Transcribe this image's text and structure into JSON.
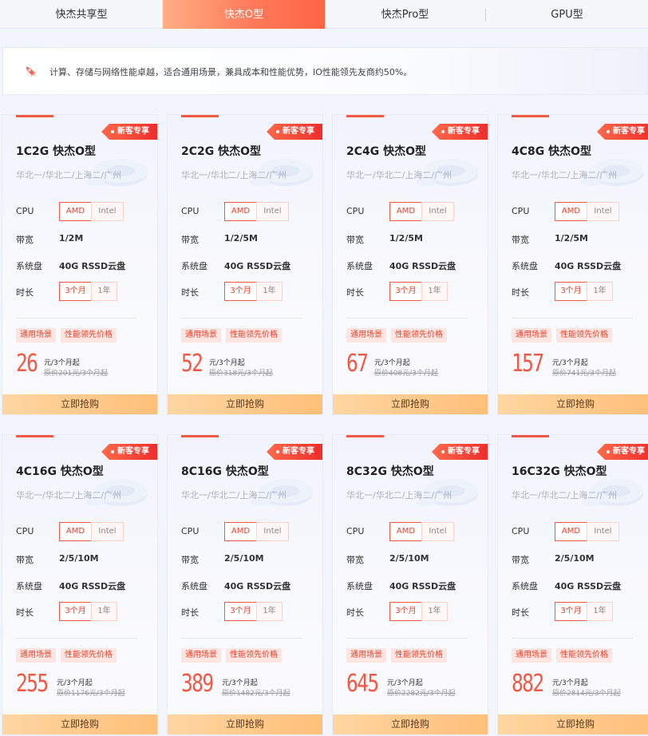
{
  "tabs": [
    {
      "label": "快杰共享型",
      "active": false
    },
    {
      "label": "快杰O型",
      "active": true
    },
    {
      "label": "快杰Pro型",
      "active": false
    },
    {
      "label": "GPU型",
      "active": false
    }
  ],
  "banner": {
    "icon": "rocket-icon",
    "text": "计算、存储与网络性能卓越，适合通用场景，兼具成本和性能优势，IO性能领先友商约50%。"
  },
  "labels": {
    "badge": "新客专享",
    "cpu": "CPU",
    "bandwidth": "带宽",
    "disk": "系统盘",
    "duration": "时长",
    "amd": "AMD",
    "intel": "Intel",
    "months3": "3个月",
    "year1": "1年",
    "tag1": "通用场景",
    "tag2": "性能领先价格",
    "price_unit": "元/3个月起",
    "buy": "立即抢购"
  },
  "colors": {
    "accent": "#f05a45",
    "buy_button": "#ffbf79",
    "tab_active": "#ff7a5a"
  },
  "cards": [
    {
      "title": "1C2G 快杰O型",
      "region": "华北一/华北二/上海二/广州",
      "bandwidth": "1/2M",
      "disk": "40G RSSD云盘",
      "price": "26",
      "original": "原价201元/3个月起"
    },
    {
      "title": "2C2G 快杰O型",
      "region": "华北一/华北二/上海二/广州",
      "bandwidth": "1/2/5M",
      "disk": "40G RSSD云盘",
      "price": "52",
      "original": "原价318元/3个月起"
    },
    {
      "title": "2C4G 快杰O型",
      "region": "华北一/华北二/上海二/广州",
      "bandwidth": "1/2/5M",
      "disk": "40G RSSD云盘",
      "price": "67",
      "original": "原价408元/3个月起"
    },
    {
      "title": "4C8G 快杰O型",
      "region": "华北一/华北二/上海二/广州",
      "bandwidth": "1/2/5M",
      "disk": "40G RSSD云盘",
      "price": "157",
      "original": "原价741元/3个月起"
    },
    {
      "title": "4C16G 快杰O型",
      "region": "华北一/华北二/上海二/广州",
      "bandwidth": "2/5/10M",
      "disk": "40G RSSD云盘",
      "price": "255",
      "original": "原价1176元/3个月起"
    },
    {
      "title": "8C16G 快杰O型",
      "region": "华北一/华北二/上海二/广州",
      "bandwidth": "2/5/10M",
      "disk": "40G RSSD云盘",
      "price": "389",
      "original": "原价1482元/3个月起"
    },
    {
      "title": "8C32G 快杰O型",
      "region": "华北一/华北二/上海二/广州",
      "bandwidth": "2/5/10M",
      "disk": "40G RSSD云盘",
      "price": "645",
      "original": "原价2282元/3个月起"
    },
    {
      "title": "16C32G 快杰O型",
      "region": "华北一/华北二/上海二/广州",
      "bandwidth": "2/5/10M",
      "disk": "40G RSSD云盘",
      "price": "882",
      "original": "原价2814元/3个月起"
    }
  ]
}
